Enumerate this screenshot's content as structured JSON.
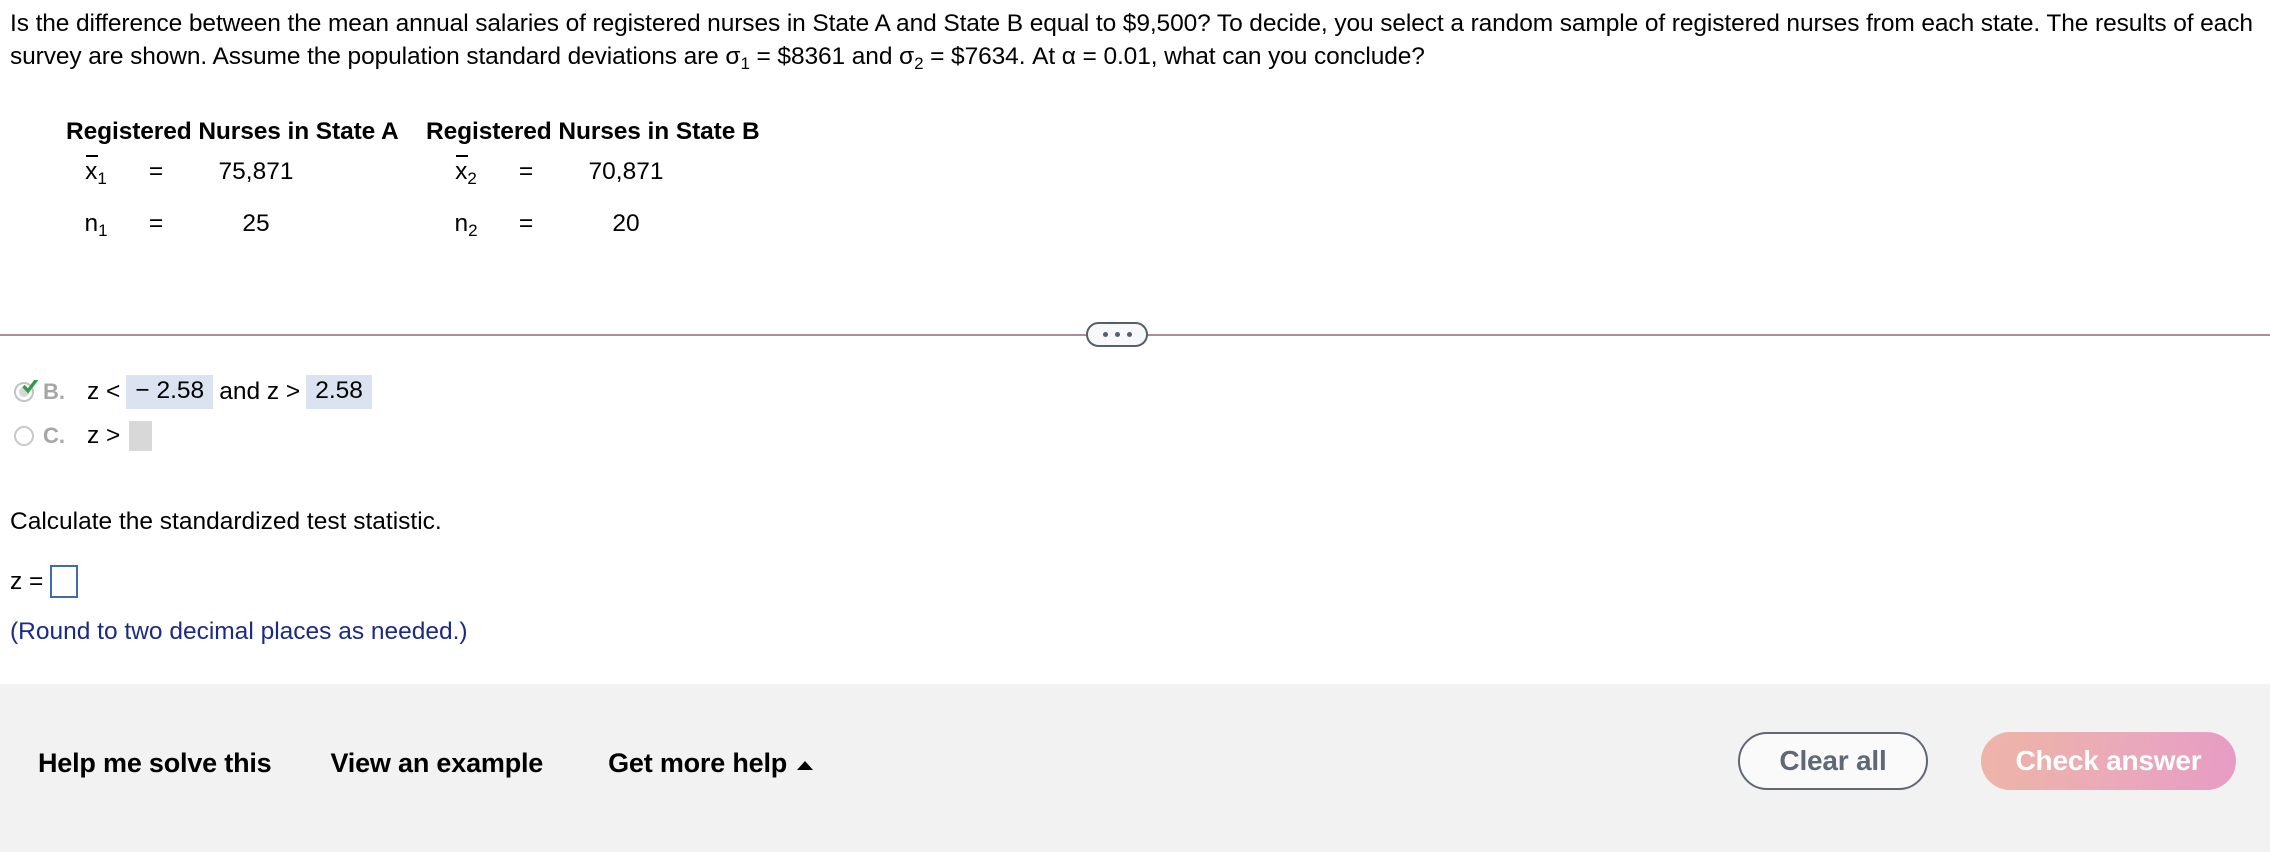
{
  "question": {
    "line1_a": "Is the difference between the mean annual salaries of registered nurses in State A and State B equal to $9,500? To decide, you select a random sample of registered nurses from each state. The",
    "line2_a": "results of each survey are shown. Assume the population standard deviations are σ",
    "sigma1_sub": "1",
    "line2_b": " = $8361 and σ",
    "sigma2_sub": "2",
    "line2_c": " = $7634. At α = 0.01, what can you conclude?"
  },
  "data_table": {
    "header_a": "Registered Nurses in State A",
    "header_b": "Registered Nurses in State B",
    "rows": [
      {
        "sym_a": "x",
        "sub_a": "1",
        "eq_a": "=",
        "val_a": "75,871",
        "sym_b": "x",
        "sub_b": "2",
        "eq_b": "=",
        "val_b": "70,871",
        "overbar": true
      },
      {
        "sym_a": "n",
        "sub_a": "1",
        "eq_a": "=",
        "val_a": "25",
        "sym_b": "n",
        "sub_b": "2",
        "eq_b": "=",
        "val_b": "20",
        "overbar": false
      }
    ]
  },
  "divider": {
    "handle_icon": "three-dots-icon",
    "line_color": "#ab8d99"
  },
  "options": [
    {
      "letter": "B.",
      "state": "selected-correct",
      "prefix": "z <",
      "value1": "− 2.58",
      "middle": "and z >",
      "value2": "2.58",
      "check_color": "#2f9e43"
    },
    {
      "letter": "C.",
      "state": "unselected",
      "prefix": "z >",
      "value1": "",
      "middle": "",
      "value2": ""
    }
  ],
  "prompt": {
    "calculate_label": "Calculate the standardized test statistic.",
    "z_label": "z =",
    "z_value": "",
    "round_note": "(Round to two decimal places as needed.)",
    "note_color": "#1b2a86"
  },
  "bottom_bar": {
    "help_me_solve": "Help me solve this",
    "view_example": "View an example",
    "get_more_help": "Get more help",
    "get_more_help_icon": "caret-up-icon",
    "clear_all": "Clear all",
    "check_answer": "Check answer",
    "check_answer_color": "#eaa8bc"
  }
}
